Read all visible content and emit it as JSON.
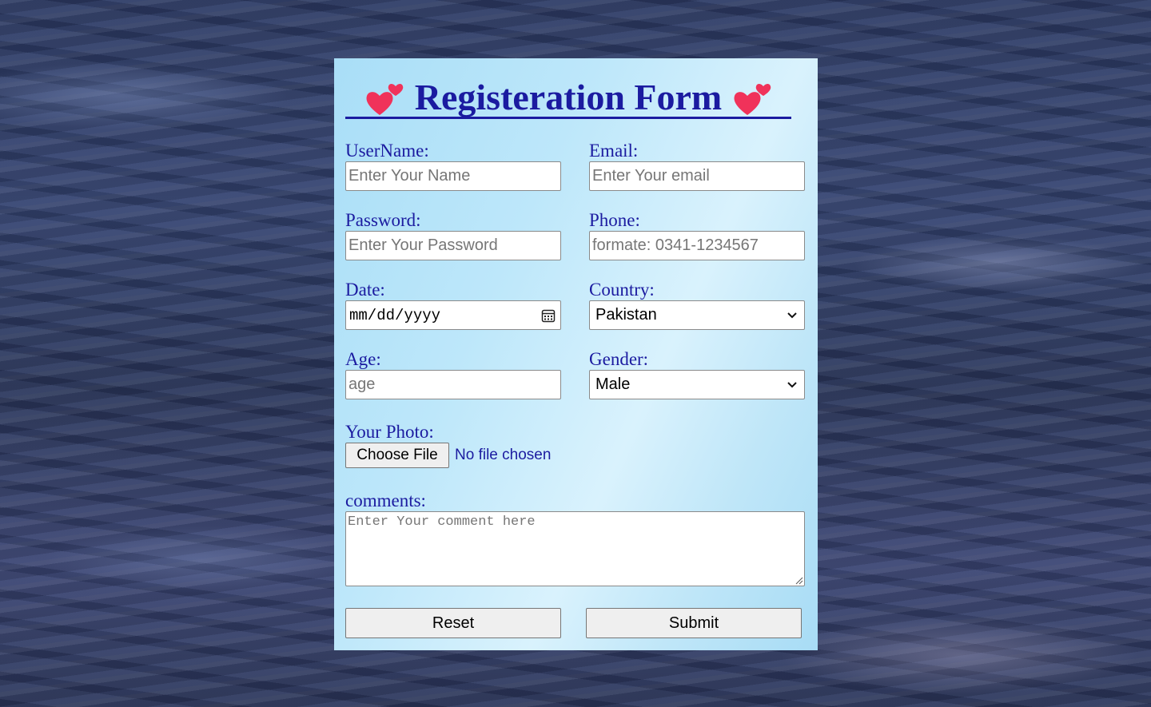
{
  "form": {
    "title": "Registeration Form",
    "heart_icon": "two-hearts-icon",
    "heart_color": "#f0325a",
    "accent_color": "#1b1ba0",
    "username": {
      "label": "UserName:",
      "placeholder": "Enter Your Name"
    },
    "email": {
      "label": "Email:",
      "placeholder": "Enter Your email"
    },
    "password": {
      "label": "Password:",
      "placeholder": "Enter Your Password"
    },
    "phone": {
      "label": "Phone:",
      "placeholder": "formate: 0341-1234567"
    },
    "date": {
      "label": "Date:",
      "placeholder": "mm/dd/yyyy"
    },
    "country": {
      "label": "Country:",
      "selected": "Pakistan"
    },
    "age": {
      "label": "Age:",
      "placeholder": "age"
    },
    "gender": {
      "label": "Gender:",
      "selected": "Male"
    },
    "photo": {
      "label": "Your Photo:",
      "button": "Choose File",
      "status": "No file chosen"
    },
    "comments": {
      "label": "comments:",
      "placeholder": "Enter Your comment here"
    },
    "reset_label": "Reset",
    "submit_label": "Submit"
  }
}
